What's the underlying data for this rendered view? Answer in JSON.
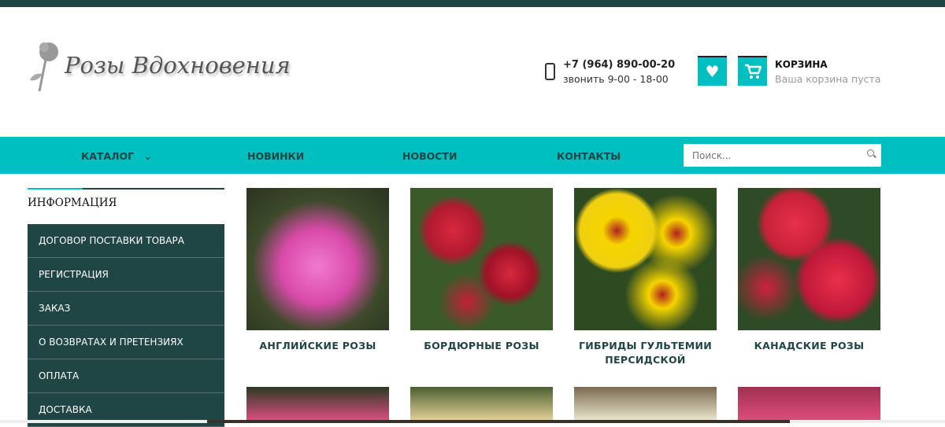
{
  "logo": {
    "text": "Розы Вдохновения"
  },
  "contact": {
    "phone": "+7 (964) 890-00-20",
    "hours": "звонить 9-00 - 18-00"
  },
  "cart": {
    "title": "КОРЗИНА",
    "status": "Ваша корзина пуста"
  },
  "nav": {
    "items": [
      "КАТАЛОГ",
      "НОВИНКИ",
      "НОВОСТИ",
      "КОНТАКТЫ"
    ]
  },
  "search": {
    "placeholder": "Поиск..."
  },
  "sidebar": {
    "title": "ИНФОРМАЦИЯ",
    "items": [
      "ДОГОВОР ПОСТАВКИ ТОВАРА",
      "РЕГИСТРАЦИЯ",
      "ЗАКАЗ",
      "О ВОЗВРАТАХ И ПРЕТЕНЗИЯХ",
      "ОПЛАТА",
      "ДОСТАВКА"
    ]
  },
  "categories": [
    "АНГЛИЙСКИЕ РОЗЫ",
    "БОРДЮРНЫЕ РОЗЫ",
    "ГИБРИДЫ ГУЛЬТЕМИИ ПЕРСИДСКОЙ",
    "КАНАДСКИЕ РОЗЫ"
  ],
  "colors": {
    "accent": "#00bfc0",
    "dark": "#1f4544"
  }
}
